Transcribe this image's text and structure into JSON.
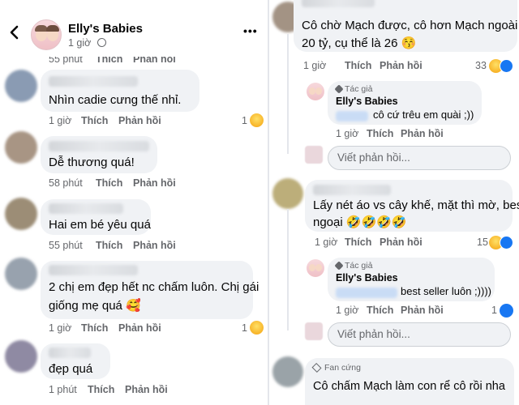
{
  "header": {
    "page_name": "Elly's Babies",
    "time": "1 giờ",
    "globe": "🌐",
    "more": "•••"
  },
  "actions": {
    "like": "Thích",
    "reply": "Phản hồi"
  },
  "left_comments": [
    {
      "time": "55 phút",
      "text": "",
      "reactions": ""
    },
    {
      "time": "1 giờ",
      "text": "Nhìn cadie cưng thế nhỉ.",
      "reactions": "1"
    },
    {
      "time": "58 phút",
      "text": "Dễ thương quá!",
      "reactions": ""
    },
    {
      "time": "55 phút",
      "text": "Hai em bé yêu quá",
      "reactions": ""
    },
    {
      "time": "1 giờ",
      "text_line1": "2 chị em đẹp hết nc chấm luôn. Chị gái",
      "text_line2": "giống mẹ quá 🥰",
      "reactions": "1"
    },
    {
      "time": "1 phút",
      "text": "đẹp quá",
      "reactions": ""
    }
  ],
  "right_thread_1": {
    "text_line1": "Cô chờ Mạch được, cô hơn Mạch ngoài",
    "text_line2": "20 tỷ, cụ thể là 26 😚",
    "time": "1 giờ",
    "reactions": "33",
    "reply": {
      "author_badge": "Tác giả",
      "author": "Elly's Babies",
      "text": "cô cứ trêu em quài ;))",
      "time": "1 giờ"
    }
  },
  "right_thread_2": {
    "text_line1": "Lấy nét áo vs cây khế, mặt thì mờ, best",
    "text_line2": "ngoại 🤣🤣🤣🤣",
    "time": "1 giờ",
    "reactions": "15",
    "reply": {
      "author_badge": "Tác giả",
      "author": "Elly's Babies",
      "text": "best seller luôn ;))))",
      "time": "1 giờ",
      "reactions": "1"
    }
  },
  "right_thread_3": {
    "badge": "Fan cứng",
    "text": "Cô chấm Mạch làm con rể cô rồi nha"
  },
  "reply_placeholder": "Viết phản hồi...",
  "colors": {
    "meta_gray": "#65676b",
    "bubble": "#f0f2f5",
    "like_blue": "#1877f2",
    "haha_yellow": "#f7b125"
  }
}
